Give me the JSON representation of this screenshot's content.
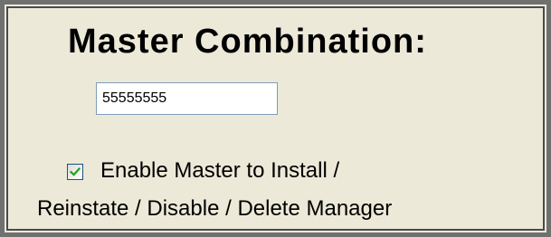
{
  "panel": {
    "title": "Master Combination:",
    "combination": {
      "value": "55555555"
    },
    "enable_master": {
      "checked": true,
      "label_line1": "Enable Master to Install /",
      "label_line2": "Reinstate / Disable /  Delete Manager"
    }
  },
  "icons": {
    "checkbox": "check-mark-icon"
  },
  "colors": {
    "panel_background": "#ece9d8",
    "border": "#707070",
    "check_mark": "#21a121",
    "input_border": "#7f9db9"
  }
}
